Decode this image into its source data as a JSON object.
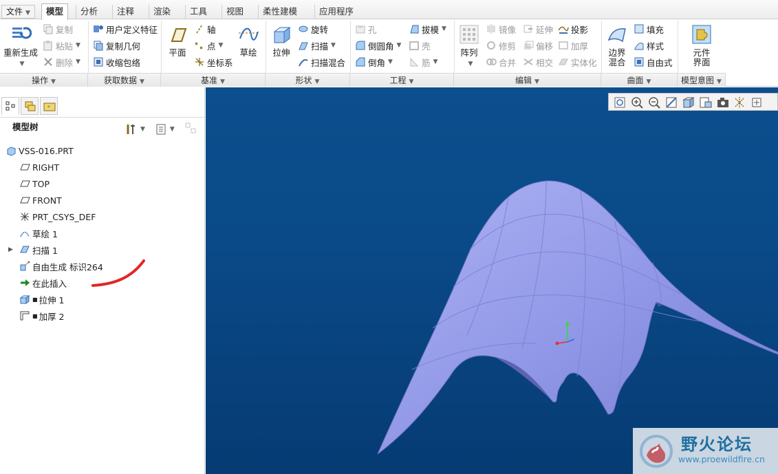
{
  "menu": {
    "file_label": "文件",
    "tabs": [
      "模型",
      "分析",
      "注释",
      "渲染",
      "工具",
      "视图",
      "柔性建模",
      "应用程序"
    ],
    "active_tab": "模型"
  },
  "ribbon": {
    "operations": {
      "regenerate": "重新生成",
      "copy": "复制",
      "paste": "粘贴",
      "delete": "删除",
      "group": "操作"
    },
    "get_data": {
      "udf": "用户定义特征",
      "copy_geom": "复制几何",
      "shrinkwrap": "收缩包络",
      "group": "获取数据"
    },
    "datum": {
      "plane": "平面",
      "axis": "轴",
      "point": "点",
      "csys": "坐标系",
      "sketch": "草绘",
      "group": "基准"
    },
    "shapes": {
      "extrude": "拉伸",
      "revolve": "旋转",
      "sweep": "扫描",
      "swept_blend": "扫描混合",
      "group": "形状"
    },
    "engineering": {
      "hole": "孔",
      "round": "倒圆角",
      "chamfer": "倒角",
      "draft": "拔模",
      "shell": "壳",
      "rib": "筋",
      "group": "工程"
    },
    "editing": {
      "pattern": "阵列",
      "mirror": "镜像",
      "trim": "修剪",
      "merge": "合并",
      "extend": "延伸",
      "offset": "偏移",
      "intersect": "相交",
      "project": "投影",
      "thicken": "加厚",
      "solidify": "实体化",
      "group": "编辑"
    },
    "surfaces": {
      "boundary_blend_1": "边界",
      "boundary_blend_2": "混合",
      "fill": "填充",
      "style": "样式",
      "freeform": "自由式",
      "group": "曲面"
    },
    "model_intent": {
      "component_interface_1": "元件",
      "component_interface_2": "界面",
      "group": "模型意图"
    }
  },
  "tree": {
    "header": "模型树",
    "items": [
      {
        "label": "VSS-016.PRT",
        "icon": "part-icon"
      },
      {
        "label": "RIGHT",
        "icon": "datum-plane-icon"
      },
      {
        "label": "TOP",
        "icon": "datum-plane-icon"
      },
      {
        "label": "FRONT",
        "icon": "datum-plane-icon"
      },
      {
        "label": "PRT_CSYS_DEF",
        "icon": "csys-icon"
      },
      {
        "label": "草绘 1",
        "icon": "sketch-icon"
      },
      {
        "label": "扫描 1",
        "icon": "sweep-icon"
      },
      {
        "label": "自由生成 标识264",
        "icon": "freeform-icon"
      },
      {
        "label": "在此插入",
        "icon": "insert-arrow-icon"
      },
      {
        "label": "拉伸 1",
        "icon": "extrude-icon"
      },
      {
        "label": "加厚 2",
        "icon": "thicken-icon"
      }
    ]
  },
  "watermark": {
    "title": "野火论坛",
    "url": "www.proewildfire.cn"
  },
  "colors": {
    "viewport_bg": "#0a4a88",
    "surface": "#8f96e6",
    "annotation_red": "#e32626"
  }
}
